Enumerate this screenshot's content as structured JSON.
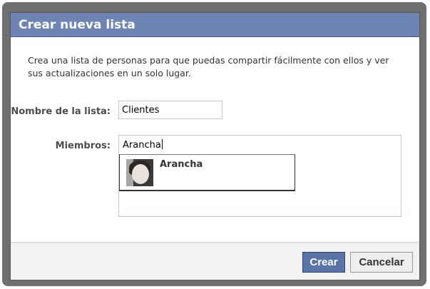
{
  "dialog": {
    "title": "Crear nueva lista",
    "description": "Crea una lista de personas para que puedas compartir fácilmente con ellos y ver sus actualizaciones en un solo lugar."
  },
  "form": {
    "list_name_label": "Nombre de la lista:",
    "list_name_value": "Clientes",
    "members_label": "Miembros:",
    "members_value": "Arancha"
  },
  "suggestion": {
    "name": "Arancha"
  },
  "buttons": {
    "create": "Crear",
    "cancel": "Cancelar"
  }
}
